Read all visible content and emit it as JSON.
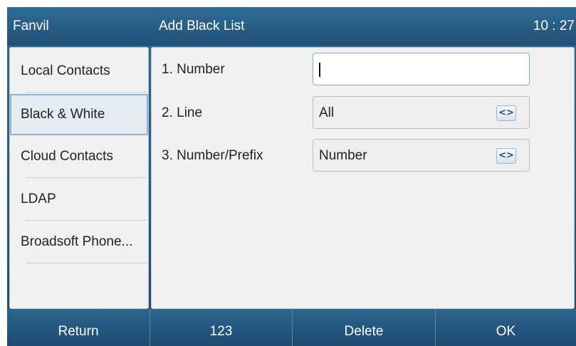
{
  "header": {
    "brand": "Fanvil",
    "title": "Add Black List",
    "time": "10 : 27"
  },
  "sidebar": {
    "items": [
      {
        "label": "Local Contacts",
        "selected": false
      },
      {
        "label": "Black & White",
        "selected": true
      },
      {
        "label": "Cloud Contacts",
        "selected": false
      },
      {
        "label": "LDAP",
        "selected": false
      },
      {
        "label": "Broadsoft Phone...",
        "selected": false
      }
    ]
  },
  "form": {
    "rows": [
      {
        "label": "1. Number",
        "type": "text-input",
        "value": ""
      },
      {
        "label": "2. Line",
        "type": "switch-select",
        "value": "All"
      },
      {
        "label": "3. Number/Prefix",
        "type": "switch-select",
        "value": "Number"
      }
    ],
    "switch_glyph": "<>"
  },
  "softkeys": [
    "Return",
    "123",
    "Delete",
    "OK"
  ]
}
